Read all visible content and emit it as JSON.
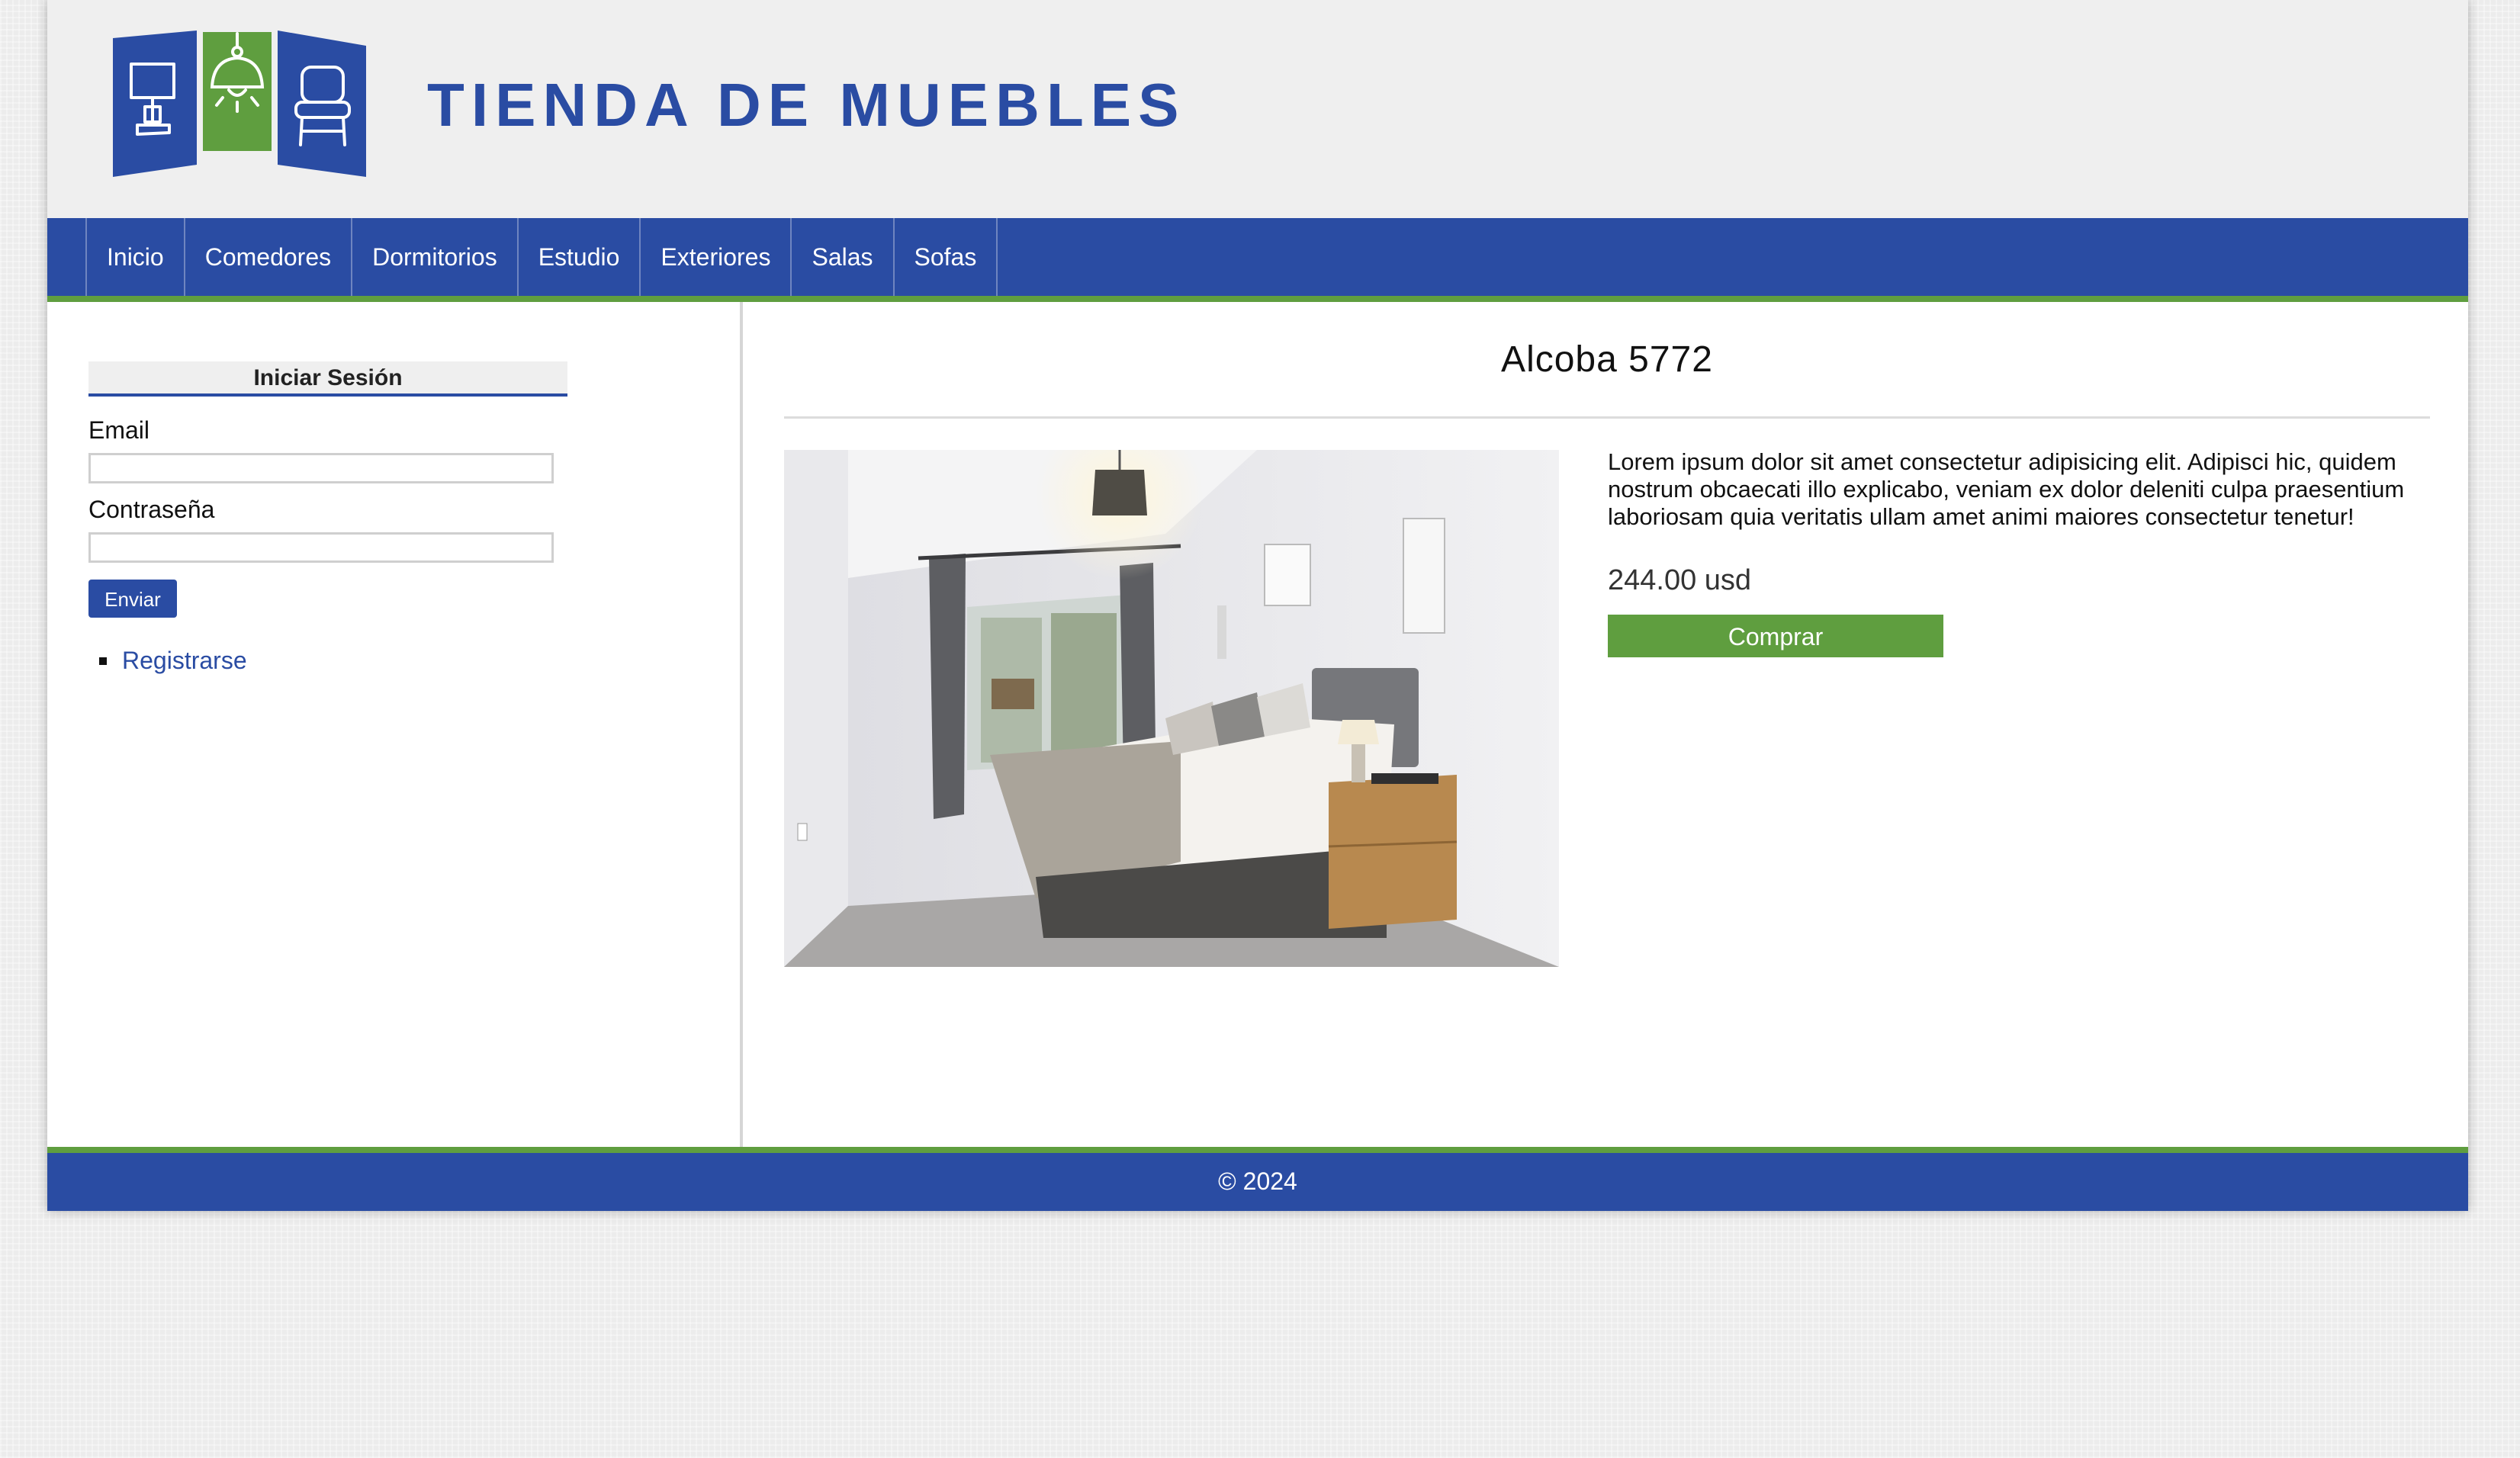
{
  "site": {
    "title": "TIENDA DE MUEBLES"
  },
  "colors": {
    "primary": "#2a4ca3",
    "accent": "#5f9e3f"
  },
  "logo": {
    "icons": [
      "lamp-icon",
      "ceiling-lamp-icon",
      "chair-icon"
    ]
  },
  "nav": {
    "items": [
      {
        "label": "Inicio"
      },
      {
        "label": "Comedores"
      },
      {
        "label": "Dormitorios"
      },
      {
        "label": "Estudio"
      },
      {
        "label": "Exteriores"
      },
      {
        "label": "Salas"
      },
      {
        "label": "Sofas"
      }
    ]
  },
  "sidebar": {
    "login_title": "Iniciar Sesión",
    "email_label": "Email",
    "password_label": "Contraseña",
    "submit_label": "Enviar",
    "register_label": "Registrarse"
  },
  "product": {
    "title": "Alcoba 5772",
    "image": "bedroom-photo",
    "description": "Lorem ipsum dolor sit amet consectetur adipisicing elit. Adipisci hic, quidem nostrum obcaecati illo explicabo, veniam ex dolor deleniti culpa praesentium laboriosam quia veritatis ullam amet animi maiores consectetur tenetur!",
    "price": "244.00 usd",
    "buy_label": "Comprar"
  },
  "footer": {
    "text": "© 2024"
  }
}
